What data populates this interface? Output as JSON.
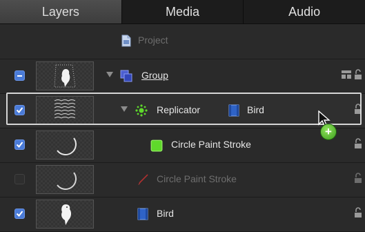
{
  "tabs": [
    {
      "label": "Layers",
      "active": true
    },
    {
      "label": "Media",
      "active": false
    },
    {
      "label": "Audio",
      "active": false
    }
  ],
  "rows": [
    {
      "label": "Project",
      "icon": "project-icon",
      "dim": true
    },
    {
      "label": "Group",
      "icon": "group-icon",
      "checkbox": "mixed",
      "expanded": true
    },
    {
      "label": "Replicator",
      "icon": "replicator-icon",
      "checkbox": "checked",
      "expanded": true,
      "source_label": "Bird",
      "source_icon": "image-layer-icon",
      "selected": true
    },
    {
      "label": "Circle Paint Stroke",
      "icon": "paint-stroke-icon",
      "checkbox": "checked"
    },
    {
      "label": "Circle Paint Stroke",
      "icon": "paint-brush-icon",
      "checkbox": "unchecked",
      "dim": true
    },
    {
      "label": "Bird",
      "icon": "image-layer-icon",
      "checkbox": "checked"
    }
  ],
  "drag_badge": "+",
  "colors": {
    "accent": "#4a7bd8",
    "add_badge": "#5cbf2a",
    "replicator": "#5fd92b",
    "paint_stroke": "#5fd92b"
  }
}
